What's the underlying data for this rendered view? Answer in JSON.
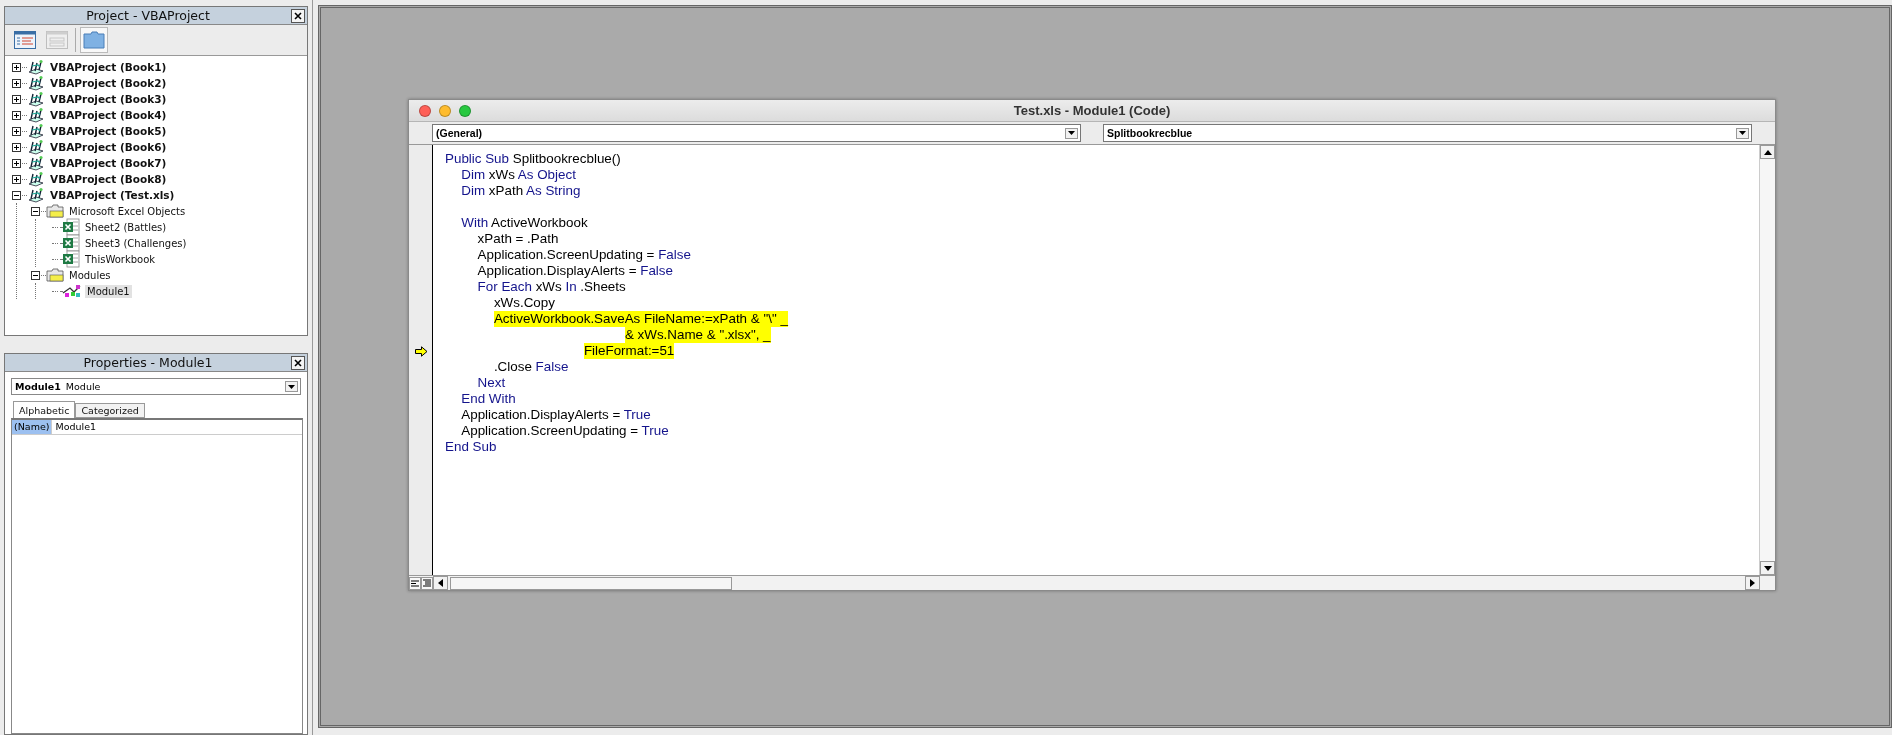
{
  "project_explorer": {
    "title": "Project - VBAProject",
    "toolbar": [
      {
        "kind": "view-code",
        "disabled": false,
        "pressed": false
      },
      {
        "kind": "view-object",
        "disabled": true,
        "pressed": false
      },
      {
        "kind": "toggle-folders",
        "disabled": false,
        "pressed": true
      }
    ],
    "tree": [
      {
        "label": "VBAProject (Book1)",
        "kind": "project",
        "expanded": false,
        "selected": false
      },
      {
        "label": "VBAProject (Book2)",
        "kind": "project",
        "expanded": false,
        "selected": false
      },
      {
        "label": "VBAProject (Book3)",
        "kind": "project",
        "expanded": false,
        "selected": false
      },
      {
        "label": "VBAProject (Book4)",
        "kind": "project",
        "expanded": false,
        "selected": false
      },
      {
        "label": "VBAProject (Book5)",
        "kind": "project",
        "expanded": false,
        "selected": false
      },
      {
        "label": "VBAProject (Book6)",
        "kind": "project",
        "expanded": false,
        "selected": false
      },
      {
        "label": "VBAProject (Book7)",
        "kind": "project",
        "expanded": false,
        "selected": false
      },
      {
        "label": "VBAProject (Book8)",
        "kind": "project",
        "expanded": false,
        "selected": false
      },
      {
        "label": "VBAProject (Test.xls)",
        "kind": "project",
        "expanded": true,
        "selected": false,
        "children": [
          {
            "label": "Microsoft Excel Objects",
            "kind": "folder",
            "expanded": true,
            "selected": false,
            "children": [
              {
                "label": "Sheet2 (Battles)",
                "kind": "sheet",
                "selected": false
              },
              {
                "label": "Sheet3 (Challenges)",
                "kind": "sheet",
                "selected": false
              },
              {
                "label": "ThisWorkbook",
                "kind": "sheet",
                "selected": false
              }
            ]
          },
          {
            "label": "Modules",
            "kind": "folder",
            "expanded": true,
            "selected": false,
            "children": [
              {
                "label": "Module1",
                "kind": "module",
                "selected": true
              }
            ]
          }
        ]
      }
    ]
  },
  "properties": {
    "title": "Properties - Module1",
    "object": {
      "name": "Module1",
      "type": "Module"
    },
    "tabs": [
      {
        "label": "Alphabetic",
        "selected": true
      },
      {
        "label": "Categorized",
        "selected": false
      }
    ],
    "rows": [
      {
        "name": "(Name)",
        "value": "Module1",
        "selected": true
      }
    ]
  },
  "code_window": {
    "title": "Test.xls - Module1 (Code)",
    "object_box": "(General)",
    "procedure_box": "Splitbookrecblue",
    "lines": [
      {
        "kind": "line",
        "segments": [
          {
            "text": "Public Sub",
            "kind": "keyword"
          },
          {
            "text": "Splitbookrecblue()",
            "kind": "plain"
          }
        ],
        "children": [
          {
            "kind": "line",
            "segments": [
              {
                "text": "Dim",
                "kind": "keyword"
              },
              {
                "text": "xWs",
                "kind": "plain"
              },
              {
                "text": "As Object",
                "kind": "keyword"
              }
            ]
          },
          {
            "kind": "line",
            "segments": [
              {
                "text": "Dim",
                "kind": "keyword"
              },
              {
                "text": "xPath",
                "kind": "plain"
              },
              {
                "text": "As String",
                "kind": "keyword"
              }
            ]
          },
          {
            "kind": "blank"
          },
          {
            "kind": "line",
            "segments": [
              {
                "text": "With",
                "kind": "keyword"
              },
              {
                "text": "ActiveWorkbook",
                "kind": "plain"
              }
            ],
            "children": [
              {
                "kind": "line",
                "segments": [
                  {
                    "text": "xPath = .Path",
                    "kind": "plain"
                  }
                ]
              },
              {
                "kind": "line",
                "segments": [
                  {
                    "text": "Application.ScreenUpdating =",
                    "kind": "plain"
                  },
                  {
                    "text": "False",
                    "kind": "keyword"
                  }
                ]
              },
              {
                "kind": "line",
                "segments": [
                  {
                    "text": "Application.DisplayAlerts =",
                    "kind": "plain"
                  },
                  {
                    "text": "False",
                    "kind": "keyword"
                  }
                ]
              },
              {
                "kind": "line",
                "segments": [
                  {
                    "text": "For Each",
                    "kind": "keyword"
                  },
                  {
                    "text": "xWs",
                    "kind": "plain"
                  },
                  {
                    "text": "In",
                    "kind": "keyword"
                  },
                  {
                    "text": ".Sheets",
                    "kind": "plain"
                  }
                ],
                "children": [
                  {
                    "kind": "line",
                    "segments": [
                      {
                        "text": "xWs.Copy",
                        "kind": "plain"
                      }
                    ]
                  },
                  {
                    "kind": "statement",
                    "highlighted": true,
                    "execution_point": true,
                    "lines": [
                      "ActiveWorkbook.SaveAs FileName:=xPath & \"\\\" _",
                      "& xWs.Name & \".xlsx\", _",
                      "FileFormat:=51"
                    ]
                  },
                  {
                    "kind": "line",
                    "segments": [
                      {
                        "text": ".Close",
                        "kind": "plain"
                      },
                      {
                        "text": "False",
                        "kind": "keyword"
                      }
                    ]
                  }
                ]
              },
              {
                "kind": "line",
                "segments": [
                  {
                    "text": "Next",
                    "kind": "keyword"
                  }
                ]
              }
            ]
          },
          {
            "kind": "line",
            "segments": [
              {
                "text": "End With",
                "kind": "keyword"
              }
            ]
          },
          {
            "kind": "line",
            "segments": [
              {
                "text": "Application.DisplayAlerts =",
                "kind": "plain"
              },
              {
                "text": "True",
                "kind": "keyword"
              }
            ]
          },
          {
            "kind": "line",
            "segments": [
              {
                "text": "Application.ScreenUpdating =",
                "kind": "plain"
              },
              {
                "text": "True",
                "kind": "keyword"
              }
            ]
          }
        ]
      },
      {
        "kind": "line",
        "segments": [
          {
            "text": "End Sub",
            "kind": "keyword"
          }
        ]
      }
    ]
  }
}
